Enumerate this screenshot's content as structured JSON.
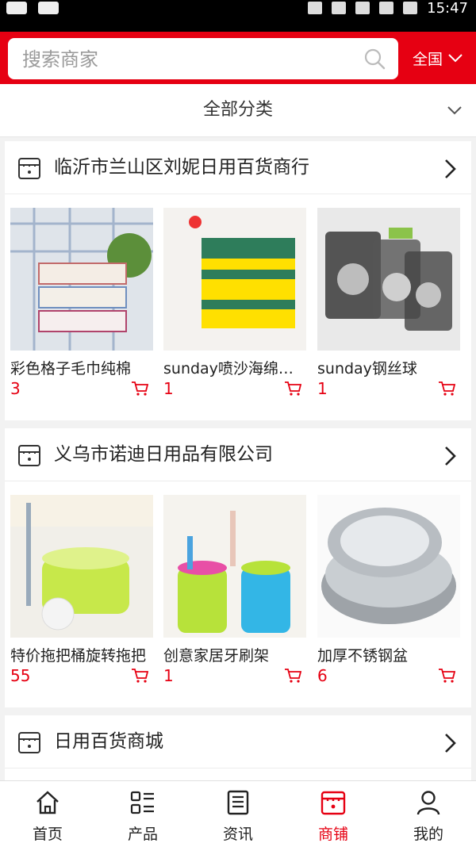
{
  "status_bar": {
    "time": "15:47"
  },
  "search": {
    "placeholder": "搜索商家",
    "region": "全国"
  },
  "category": {
    "label": "全部分类"
  },
  "shops": [
    {
      "name": "临沂市兰山区刘妮日用百货商行",
      "products": [
        {
          "name": "彩色格子毛巾纯棉",
          "price": "3"
        },
        {
          "name": "sunday喷沙海绵…",
          "price": "1"
        },
        {
          "name": "sunday钢丝球",
          "price": "1"
        }
      ]
    },
    {
      "name": "义乌市诺迪日用品有限公司",
      "products": [
        {
          "name": "特价拖把桶旋转拖把",
          "price": "55"
        },
        {
          "name": "创意家居牙刷架",
          "price": "1"
        },
        {
          "name": "加厚不锈钢盆",
          "price": "6"
        }
      ]
    },
    {
      "name": "日用百货商城",
      "products": []
    }
  ],
  "tabs": [
    {
      "label": "首页",
      "icon": "home-icon"
    },
    {
      "label": "产品",
      "icon": "grid-list-icon"
    },
    {
      "label": "资讯",
      "icon": "news-icon"
    },
    {
      "label": "商铺",
      "icon": "shop-icon",
      "active": true
    },
    {
      "label": "我的",
      "icon": "user-icon"
    }
  ],
  "colors": {
    "accent": "#e60012",
    "background": "#f2f2f2"
  }
}
